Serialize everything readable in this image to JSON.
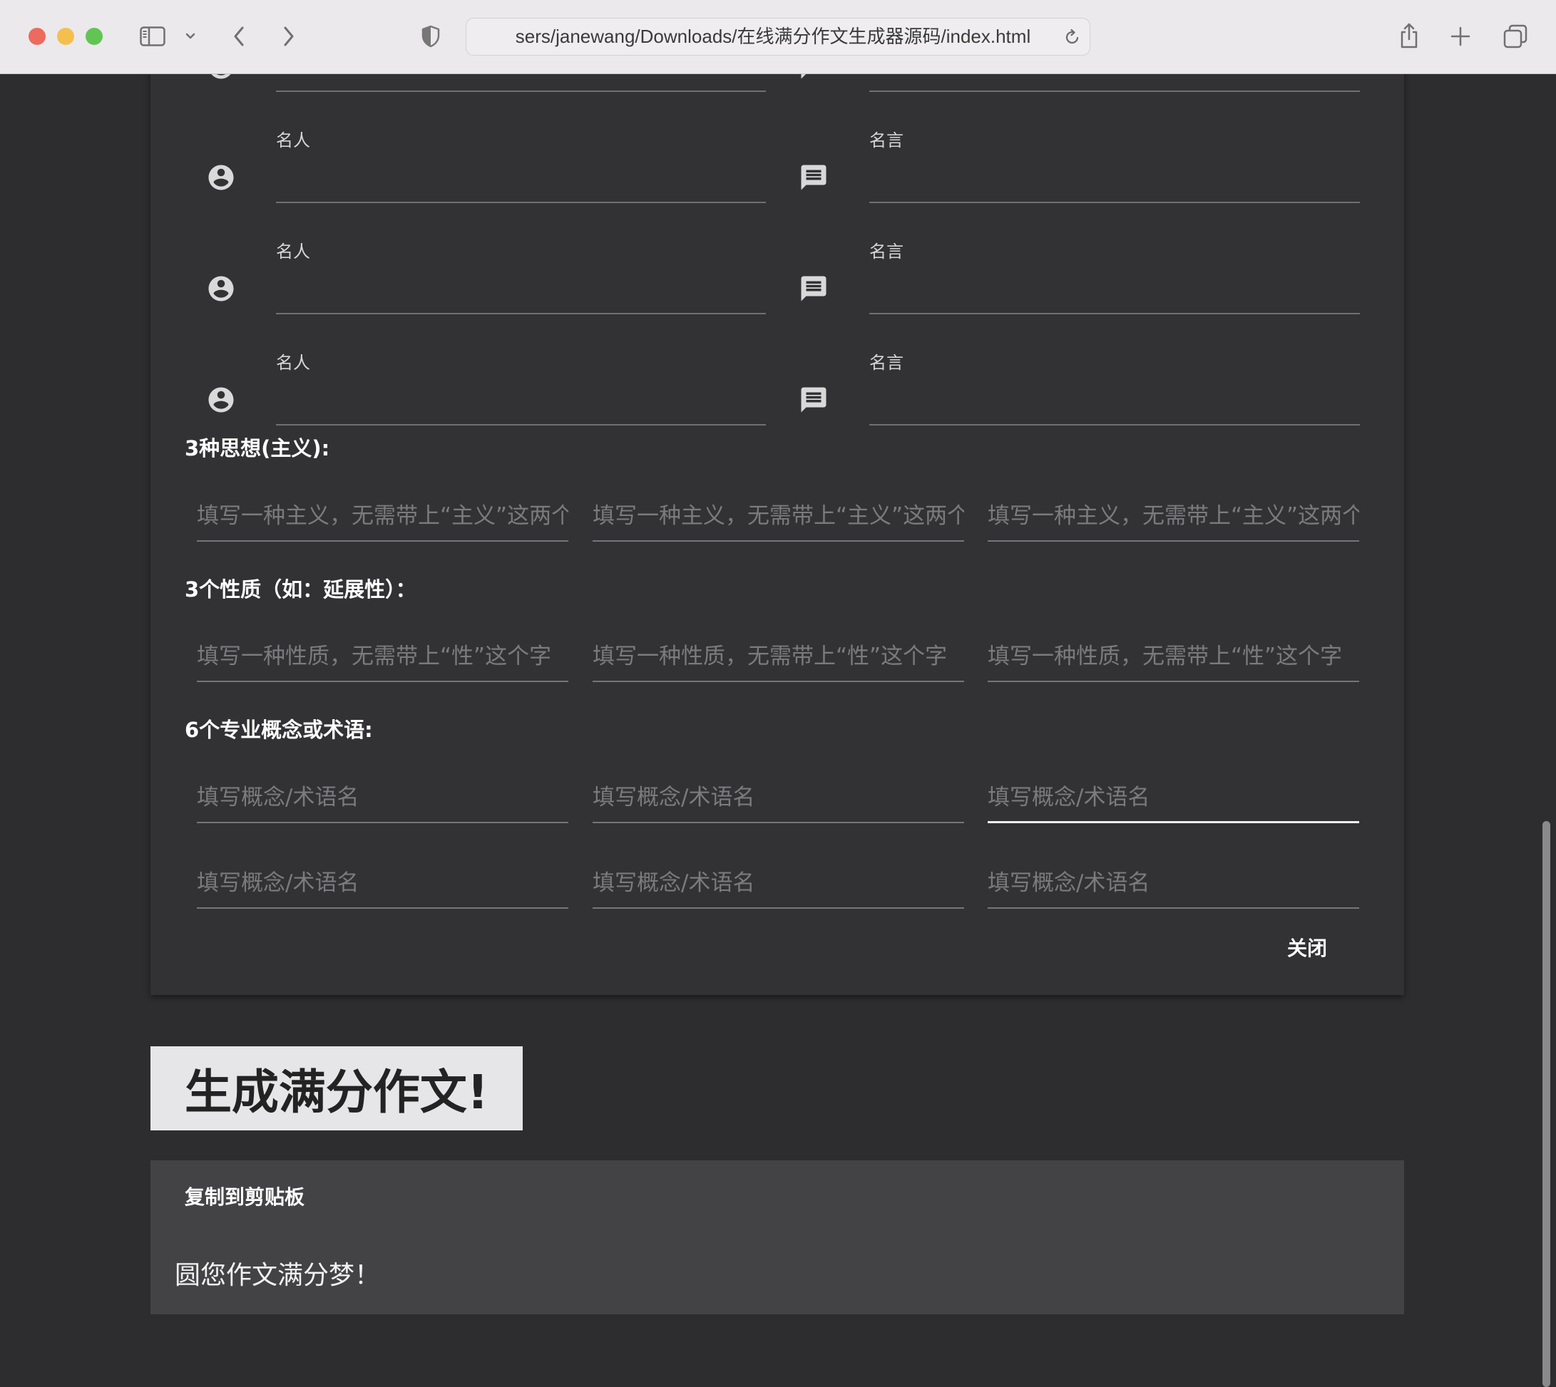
{
  "browser": {
    "url": "sers/janewang/Downloads/在线满分作文生成器源码/index.html",
    "traffic_light_colors": {
      "close": "#ed6a5e",
      "minimize": "#f5bf4f",
      "zoom": "#61c554"
    },
    "icons": [
      "sidebar-icon",
      "chevron-down-icon",
      "back-icon",
      "forward-icon",
      "shield-icon",
      "reload-icon",
      "share-icon",
      "new-tab-icon",
      "tab-overview-icon"
    ]
  },
  "theme": {
    "page_bg": "#2d2c2f",
    "card_bg": "#323134",
    "output_bg": "#434245",
    "button_bg": "#e6e5e7"
  },
  "famous_quotes": {
    "person_icon": "account-circle-icon",
    "quote_icon": "message-icon",
    "partial_row": {
      "person_value": "",
      "quote_value": ""
    },
    "rows": [
      {
        "person_label": "名人",
        "person_value": "",
        "quote_label": "名言",
        "quote_value": ""
      },
      {
        "person_label": "名人",
        "person_value": "",
        "quote_label": "名言",
        "quote_value": ""
      },
      {
        "person_label": "名人",
        "person_value": "",
        "quote_label": "名言",
        "quote_value": ""
      }
    ]
  },
  "ideologies": {
    "heading": "3种思想(主义):",
    "fields": [
      {
        "placeholder": "填写一种主义，无需带上“主义”这两个",
        "value": ""
      },
      {
        "placeholder": "填写一种主义，无需带上“主义”这两个",
        "value": ""
      },
      {
        "placeholder": "填写一种主义，无需带上“主义”这两个",
        "value": ""
      }
    ]
  },
  "properties": {
    "heading": "3个性质（如：延展性）：",
    "fields": [
      {
        "placeholder": "填写一种性质，无需带上“性”这个字",
        "value": ""
      },
      {
        "placeholder": "填写一种性质，无需带上“性”这个字",
        "value": ""
      },
      {
        "placeholder": "填写一种性质，无需带上“性”这个字",
        "value": ""
      }
    ]
  },
  "concepts": {
    "heading": "6个专业概念或术语:",
    "focused_index": 2,
    "fields": [
      {
        "placeholder": "填写概念/术语名",
        "value": ""
      },
      {
        "placeholder": "填写概念/术语名",
        "value": ""
      },
      {
        "placeholder": "填写概念/术语名",
        "value": ""
      },
      {
        "placeholder": "填写概念/术语名",
        "value": ""
      },
      {
        "placeholder": "填写概念/术语名",
        "value": ""
      },
      {
        "placeholder": "填写概念/术语名",
        "value": ""
      }
    ]
  },
  "dialog": {
    "close_label": "关闭"
  },
  "generate": {
    "label": "生成满分作文!"
  },
  "output": {
    "copy_label": "复制到剪贴板",
    "text": "圆您作文满分梦！"
  }
}
